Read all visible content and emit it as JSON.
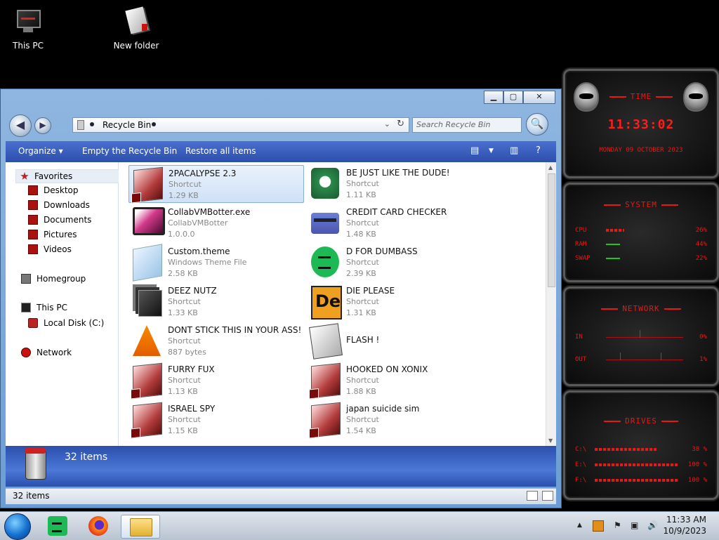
{
  "desktop": {
    "icons": [
      {
        "label": "This PC",
        "icon": "pc-icon"
      },
      {
        "label": "New folder",
        "icon": "folder-icon"
      }
    ]
  },
  "window": {
    "controls": {
      "minimize": "▁",
      "maximize": "▢",
      "close": "✕"
    },
    "address": {
      "crumb": "Recycle Bin"
    },
    "search": {
      "placeholder": "Search Recycle Bin"
    },
    "toolbar": {
      "organize": "Organize ▾",
      "empty": "Empty the Recycle Bin",
      "restore": "Restore all items"
    },
    "nav": {
      "favorites": "Favorites",
      "desktop": "Desktop",
      "downloads": "Downloads",
      "documents": "Documents",
      "pictures": "Pictures",
      "videos": "Videos",
      "homegroup": "Homegroup",
      "thispc": "This PC",
      "localdisk": "Local Disk (C:)",
      "network": "Network"
    },
    "files": [
      {
        "name": "2PACALYPSE 2.3",
        "type": "Shortcut",
        "size": "1.29 KB",
        "icon": "shortcut-icon"
      },
      {
        "name": "BE JUST LIKE THE DUDE!",
        "type": "Shortcut",
        "size": "1.11 KB",
        "icon": "santa-icon"
      },
      {
        "name": "CollabVMBotter.exe",
        "type": "CollabVMBotter",
        "size": "1.0.0.0",
        "icon": "monitor-icon"
      },
      {
        "name": "CREDIT CARD CHECKER",
        "type": "Shortcut",
        "size": "1.48 KB",
        "icon": "credit-card-icon"
      },
      {
        "name": "Custom.theme",
        "type": "Windows Theme File",
        "size": "2.58 KB",
        "icon": "theme-icon"
      },
      {
        "name": "D FOR DUMBASS",
        "type": "Shortcut",
        "size": "2.39 KB",
        "icon": "spotify-icon"
      },
      {
        "name": "DEEZ NUTZ",
        "type": "Shortcut",
        "size": "1.33 KB",
        "icon": "stack-icon"
      },
      {
        "name": "DIE PLEASE",
        "type": "Shortcut",
        "size": "1.31 KB",
        "icon": "de-icon"
      },
      {
        "name": "DONT STICK THIS IN YOUR ASS!",
        "type": "Shortcut",
        "size": "887 bytes",
        "icon": "vlc-icon"
      },
      {
        "name": "FLASH !",
        "type": "",
        "size": "",
        "icon": "flash-icon"
      },
      {
        "name": "FURRY FUX",
        "type": "Shortcut",
        "size": "1.13 KB",
        "icon": "shortcut-icon"
      },
      {
        "name": "HOOKED ON XONIX",
        "type": "Shortcut",
        "size": "1.88 KB",
        "icon": "shortcut-icon"
      },
      {
        "name": "ISRAEL SPY",
        "type": "Shortcut",
        "size": "1.15 KB",
        "icon": "shortcut-icon"
      },
      {
        "name": "japan suicide sim",
        "type": "Shortcut",
        "size": "1.54 KB",
        "icon": "shortcut-icon"
      }
    ],
    "details": {
      "count": "32 items"
    },
    "status": {
      "count": "32 items"
    }
  },
  "gadgets": {
    "time": {
      "title": "TIME",
      "clock": "11:33:02",
      "date": "MONDAY 09 OCTOBER 2023"
    },
    "system": {
      "title": "SYSTEM",
      "cpu_label": "CPU",
      "cpu_value": "26%",
      "ram_label": "RAM",
      "ram_value": "44%",
      "swap_label": "SWAP",
      "swap_value": "22%"
    },
    "network": {
      "title": "NETWORK",
      "in_label": "IN",
      "in_value": "0%",
      "out_label": "OUT",
      "out_value": "1%"
    },
    "drives": {
      "title": "DRIVES",
      "c_label": "C:\\",
      "c_value": "38 %",
      "e_label": "E:\\",
      "e_value": "100 %",
      "f_label": "F:\\",
      "f_value": "100 %"
    },
    "colors": {
      "accent": "#e81818",
      "bg": "#111111"
    }
  },
  "taskbar": {
    "time": "11:33 AM",
    "date": "10/9/2023"
  }
}
